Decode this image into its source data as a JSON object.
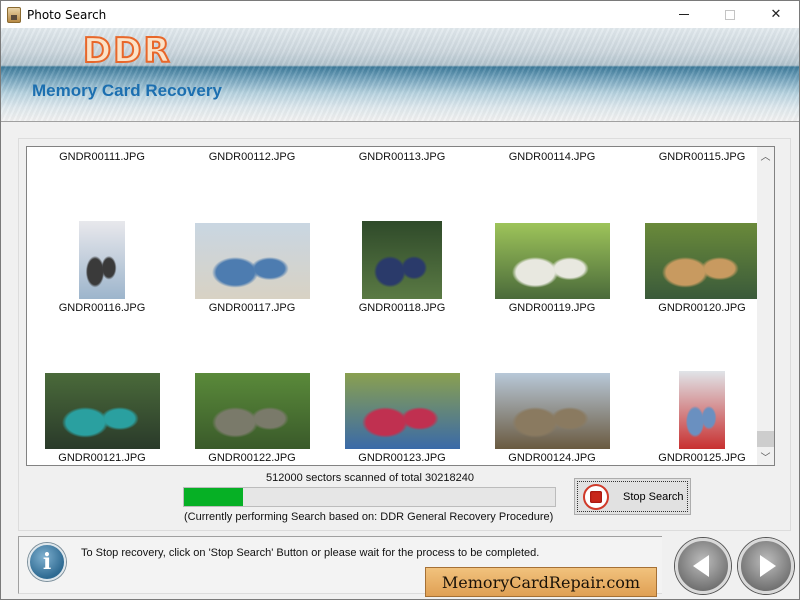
{
  "window": {
    "title": "Photo Search",
    "minimize": "minimize",
    "maximize": "maximize",
    "close": "close"
  },
  "banner": {
    "logo": "DDR",
    "subtitle": "Memory Card Recovery",
    "logo_color": "#e8672a",
    "subtitle_color": "#1c6fb0"
  },
  "thumbnails": {
    "rows": [
      [
        {
          "name": "GNDR00111.JPG",
          "has_image": false
        },
        {
          "name": "GNDR00112.JPG",
          "has_image": false
        },
        {
          "name": "GNDR00113.JPG",
          "has_image": false
        },
        {
          "name": "GNDR00114.JPG",
          "has_image": false
        },
        {
          "name": "GNDR00115.JPG",
          "has_image": false
        }
      ],
      [
        {
          "name": "GNDR00116.JPG",
          "has_image": true,
          "orientation": "portrait",
          "colors": [
            "#e8e8ec",
            "#9db5cc",
            "#3a3a3a"
          ]
        },
        {
          "name": "GNDR00117.JPG",
          "has_image": true,
          "orientation": "landscape",
          "colors": [
            "#c9d6e2",
            "#d8d2c4",
            "#4d7cb0"
          ]
        },
        {
          "name": "GNDR00118.JPG",
          "has_image": true,
          "orientation": "square",
          "colors": [
            "#2f4a2a",
            "#5a7a44",
            "#2a3a6a"
          ]
        },
        {
          "name": "GNDR00119.JPG",
          "has_image": true,
          "orientation": "landscape",
          "colors": [
            "#9ec45a",
            "#4a6a3a",
            "#e8e8e0"
          ]
        },
        {
          "name": "GNDR00120.JPG",
          "has_image": true,
          "orientation": "landscape",
          "colors": [
            "#6a8a3a",
            "#3a5a3a",
            "#c89a60"
          ]
        }
      ],
      [
        {
          "name": "GNDR00121.JPG",
          "has_image": true,
          "orientation": "landscape",
          "colors": [
            "#4a6a3a",
            "#2a3a2a",
            "#2aa0a0"
          ]
        },
        {
          "name": "GNDR00122.JPG",
          "has_image": true,
          "orientation": "landscape",
          "colors": [
            "#5a8a3a",
            "#3a5a2a",
            "#7a7a6a"
          ]
        },
        {
          "name": "GNDR00123.JPG",
          "has_image": true,
          "orientation": "landscape",
          "colors": [
            "#8aa050",
            "#3a6aa8",
            "#c03050"
          ]
        },
        {
          "name": "GNDR00124.JPG",
          "has_image": true,
          "orientation": "landscape",
          "colors": [
            "#b8c8d8",
            "#6a5a40",
            "#8a7a60"
          ]
        },
        {
          "name": "GNDR00125.JPG",
          "has_image": true,
          "orientation": "portrait",
          "colors": [
            "#e0e4e8",
            "#c83030",
            "#6a90c0"
          ]
        }
      ]
    ]
  },
  "scrollbar": {
    "up": "▲",
    "down": "▼"
  },
  "progress": {
    "status": "512000 sectors scanned of total 30218240",
    "scanned": 512000,
    "total": 30218240,
    "fraction": 0.16,
    "procedure": "(Currently performing Search based on:  DDR General Recovery Procedure)",
    "fill_color": "#06b025"
  },
  "stop_button": {
    "label": "Stop Search"
  },
  "info": {
    "message": "To Stop recovery, click on 'Stop Search' Button or please wait for the process to be completed.",
    "icon_glyph": "i"
  },
  "site_badge": {
    "text": "MemoryCardRepair.com"
  },
  "nav": {
    "back": "back",
    "next": "next"
  }
}
